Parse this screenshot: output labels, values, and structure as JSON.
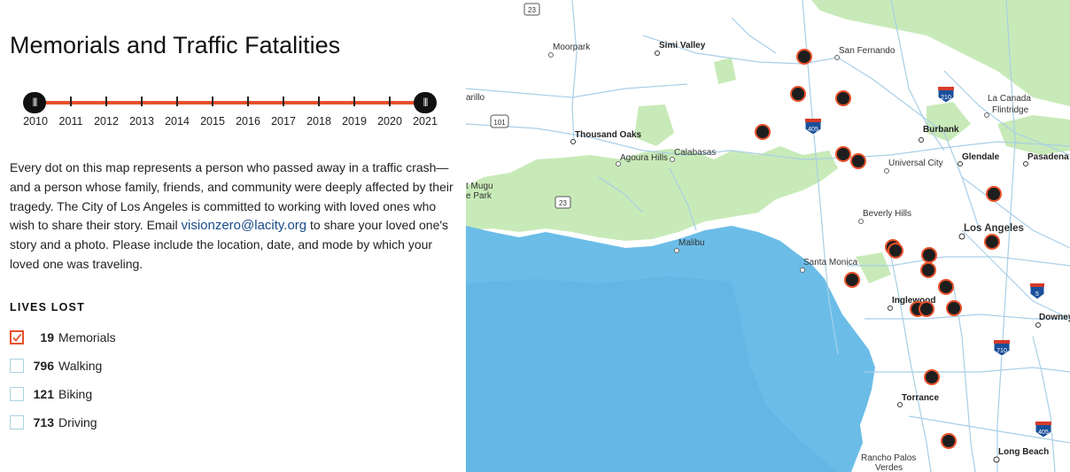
{
  "title": "Memorials and Traffic Fatalities",
  "timeline": {
    "years": [
      "2010",
      "2011",
      "2012",
      "2013",
      "2014",
      "2015",
      "2016",
      "2017",
      "2018",
      "2019",
      "2020",
      "2021"
    ],
    "range_start": "2010",
    "range_end": "2021",
    "handle_glyph": "|||"
  },
  "intro": {
    "text_before": "Every dot on this map represents a person who passed away in a traffic crash—and a person whose family, friends, and community were deeply affected by their tragedy. The City of Los Angeles is committed to working with loved ones who wish to share their story. Email ",
    "email": "visionzero@lacity.org",
    "text_after": " to share your loved one's story and a photo. Please include the location, date, and mode by which your loved one was traveling."
  },
  "lives_lost": {
    "heading": "LIVES LOST",
    "items": [
      {
        "count": "19",
        "label": "Memorials",
        "checked": true
      },
      {
        "count": "796",
        "label": "Walking",
        "checked": false
      },
      {
        "count": "121",
        "label": "Biking",
        "checked": false
      },
      {
        "count": "713",
        "label": "Driving",
        "checked": false
      }
    ]
  },
  "colors": {
    "accent": "#e8502a",
    "checkbox_border": "#a9d4df",
    "ocean": "#6bbde8",
    "land": "#ffffff",
    "parks": "#c8eab8",
    "roads": "#a8cfe6",
    "marker_fill": "#1e1e1e",
    "link": "#1a4c8a"
  },
  "map": {
    "places": [
      {
        "name": "Simi Valley",
        "bold": true
      },
      {
        "name": "Moorpark",
        "bold": false
      },
      {
        "name": "San Fernando",
        "bold": false
      },
      {
        "name": "La Canada Flintridge",
        "bold": false
      },
      {
        "name": "Thousand Oaks",
        "bold": true
      },
      {
        "name": "Agoura Hills",
        "bold": false
      },
      {
        "name": "Calabasas",
        "bold": false
      },
      {
        "name": "Burbank",
        "bold": true
      },
      {
        "name": "Universal City",
        "bold": false
      },
      {
        "name": "Glendale",
        "bold": true
      },
      {
        "name": "Pasadena",
        "bold": true
      },
      {
        "name": "Beverly Hills",
        "bold": false
      },
      {
        "name": "Los Angeles",
        "bold": true
      },
      {
        "name": "Malibu",
        "bold": false
      },
      {
        "name": "Santa Monica",
        "bold": false
      },
      {
        "name": "Inglewood",
        "bold": true
      },
      {
        "name": "Downey",
        "bold": true
      },
      {
        "name": "Torrance",
        "bold": true
      },
      {
        "name": "Long Beach",
        "bold": true
      },
      {
        "name": "Rancho Palos Verdes",
        "bold": false
      },
      {
        "name": "Camarillo",
        "bold": false
      },
      {
        "name": "Point Mugu State Park",
        "bold": false
      }
    ],
    "highway_shields": [
      "23",
      "101",
      "23",
      "405",
      "210",
      "5",
      "710",
      "405"
    ],
    "memorial_marker_count": 19
  }
}
